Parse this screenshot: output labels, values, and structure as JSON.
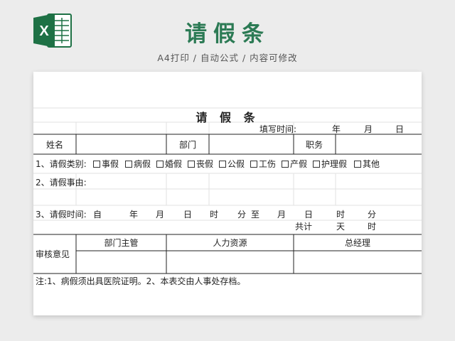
{
  "banner": {
    "title": "请假条",
    "subtitle": "A4打印 / 自动公式 / 内容可修改"
  },
  "icons": {
    "app": "excel-icon"
  },
  "colors": {
    "brand_green": "#2b7a54",
    "excel_green": "#1e7145"
  },
  "form": {
    "title": "请 假 条",
    "fill_time_label": "填写时间:",
    "year": "年",
    "month": "月",
    "day": "日",
    "name_label": "姓名",
    "dept_label": "部门",
    "position_label": "职务",
    "leave_type_label": "1、请假类别:",
    "leave_types": [
      "事假",
      "病假",
      "婚假",
      "丧假",
      "公假",
      "工伤",
      "产假",
      "护理假",
      "其他"
    ],
    "reason_label": "2、请假事由:",
    "time_label": "3、请假时间:",
    "from": "自",
    "to": "至",
    "hour": "时",
    "minute": "分",
    "total": "共计",
    "days": "天",
    "hours": "时",
    "approval_label": "审核意见",
    "approvers": [
      "部门主管",
      "人力资源",
      "总经理"
    ],
    "note": "注:1、病假须出具医院证明。2、本表交由人事处存档。"
  }
}
